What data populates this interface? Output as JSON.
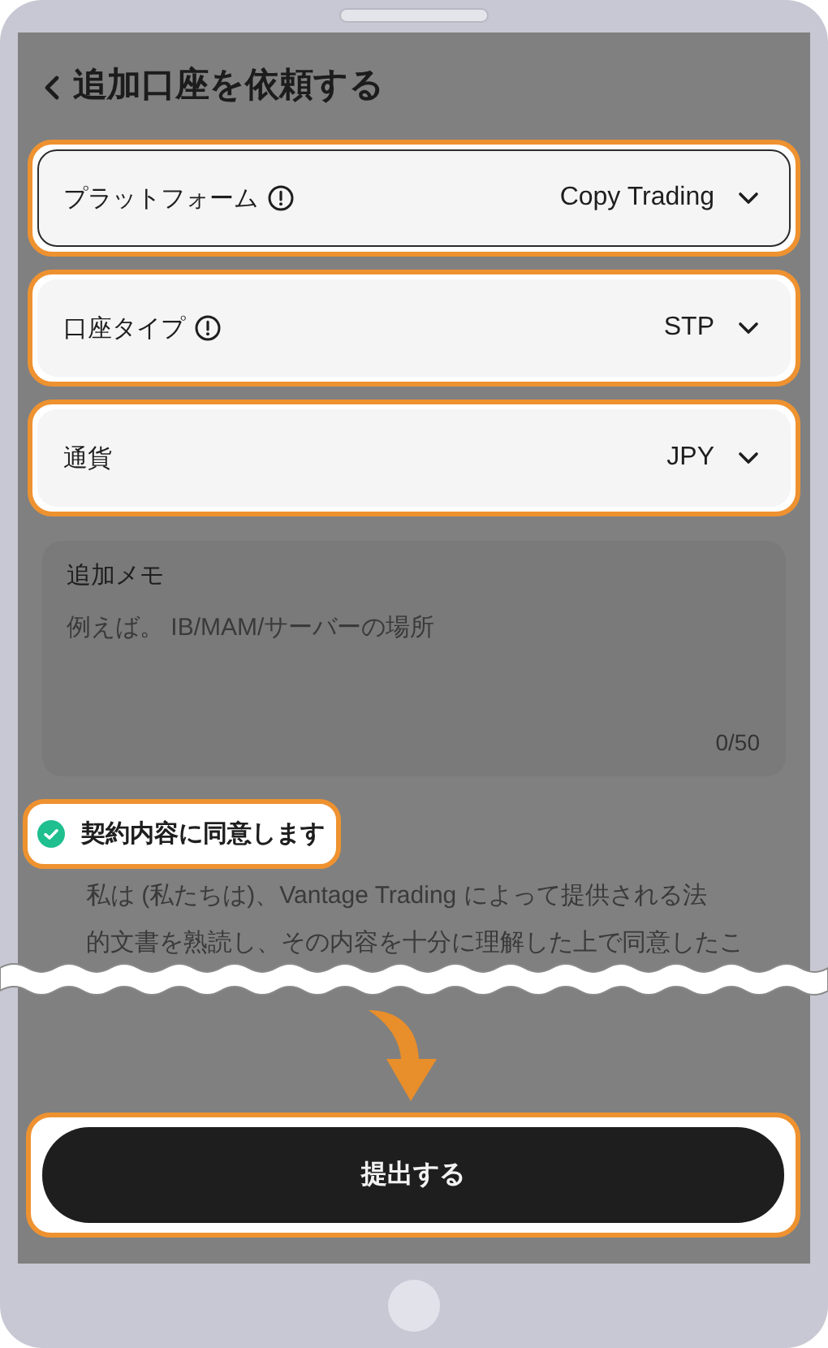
{
  "header": {
    "title": "追加口座を依頼する"
  },
  "fields": [
    {
      "label": "プラットフォーム",
      "info": true,
      "value": "Copy Trading",
      "highlighted": true,
      "focused": true
    },
    {
      "label": "口座タイプ",
      "info": true,
      "value": "STP",
      "highlighted": true,
      "focused": false
    },
    {
      "label": "通貨",
      "info": false,
      "value": "JPY",
      "highlighted": true,
      "focused": false
    }
  ],
  "memo": {
    "label": "追加メモ",
    "placeholder": "例えば。 IB/MAM/サーバーの場所",
    "counter": "0/50"
  },
  "agreement": {
    "label": "契約内容に同意します",
    "checked": true,
    "highlighted": true,
    "text_lines": [
      "私は (私たちは)、Vantage Trading によって提供される法",
      "的文書を熟読し、その内容を十分に理解した上で同意したこ"
    ]
  },
  "submit": {
    "label": "提出する",
    "highlighted": true
  }
}
